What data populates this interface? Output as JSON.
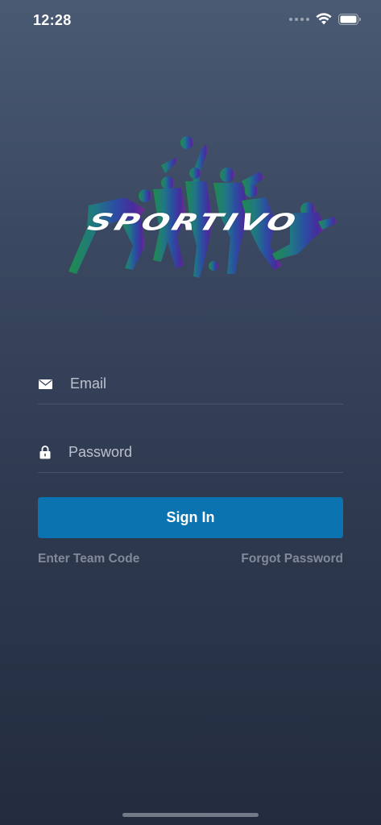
{
  "status_bar": {
    "time": "12:28",
    "icons": [
      "signal-dots-icon",
      "wifi-icon",
      "battery-icon"
    ]
  },
  "logo": {
    "text": "SPORTIVO",
    "colors": [
      "#1e8f4a",
      "#1f6fa8",
      "#3a2aa0",
      "#6a2a9a"
    ]
  },
  "form": {
    "email": {
      "placeholder": "Email",
      "value": "",
      "icon": "envelope-icon"
    },
    "password": {
      "placeholder": "Password",
      "value": "",
      "icon": "lock-icon"
    },
    "signin_label": "Sign In",
    "signin_color": "#0b74b0"
  },
  "links": {
    "team_code": "Enter Team Code",
    "forgot_password": "Forgot Password"
  }
}
